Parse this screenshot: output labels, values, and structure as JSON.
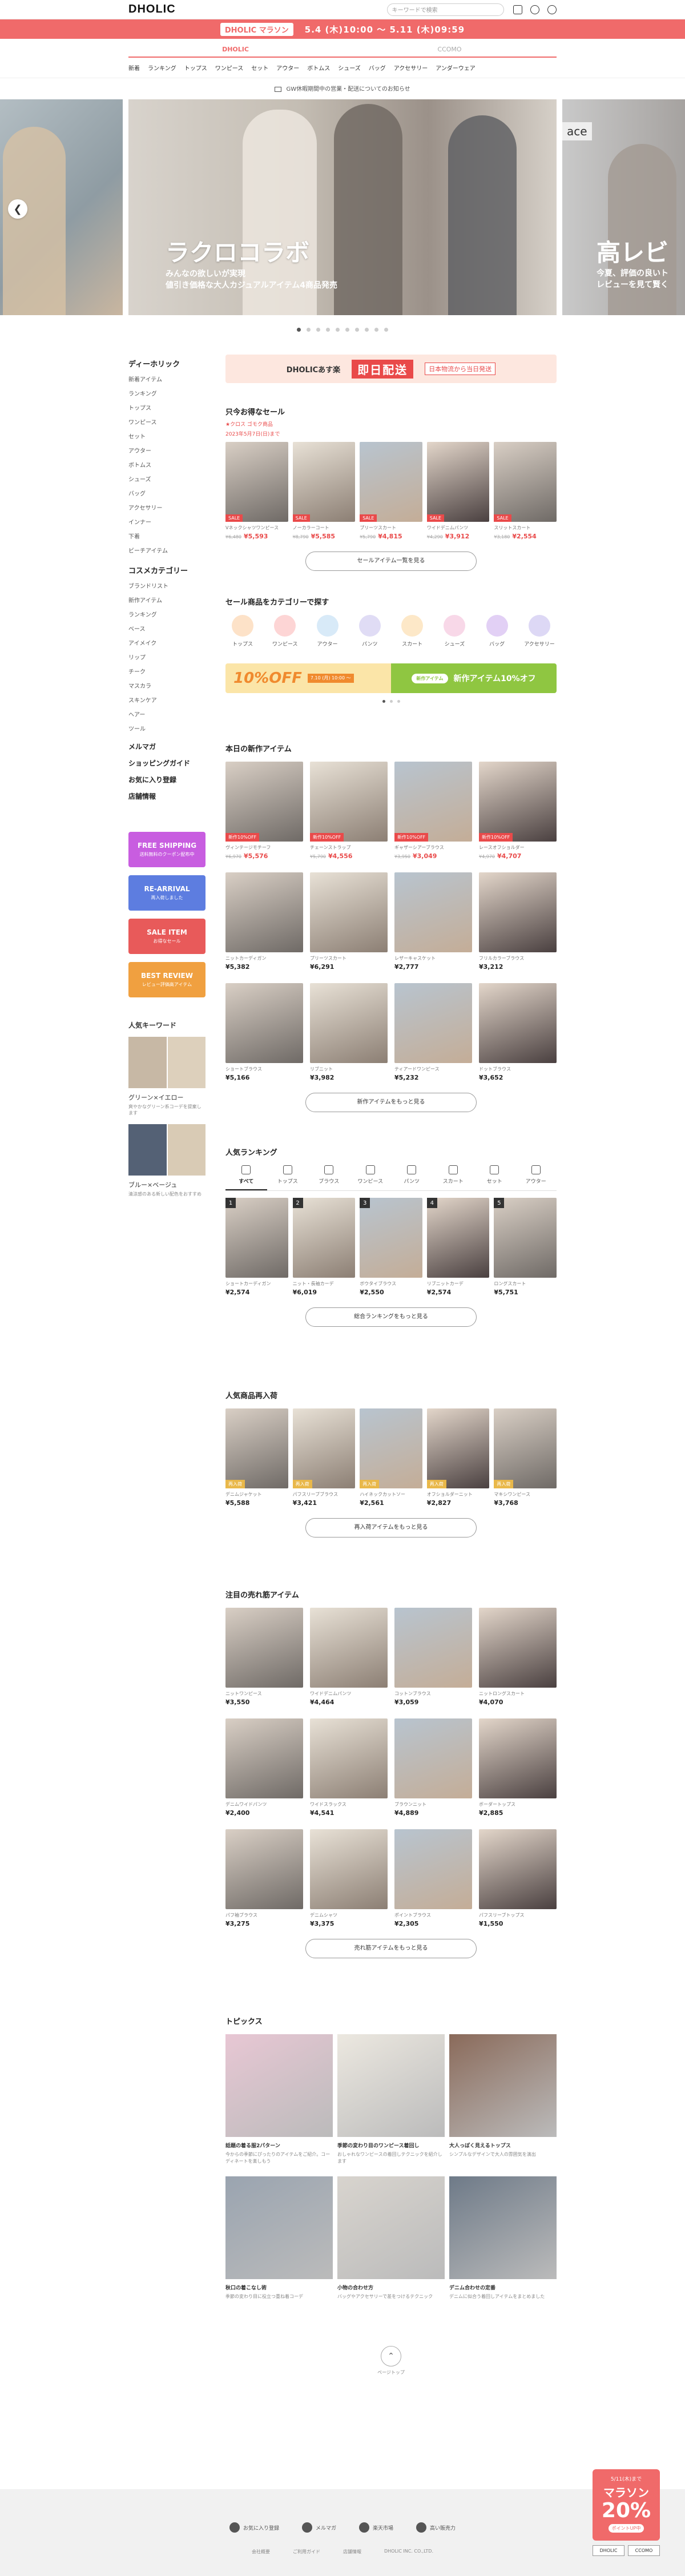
{
  "header": {
    "logo": "DHOLIC",
    "search_placeholder": "キーワードで検索",
    "promo_badge": "DHOLIC マラソン",
    "promo_dates": "5.4 (木)10:00 ～ 5.11 (木)09:59",
    "brand_tabs": [
      "DHOLIC",
      "CCOMO"
    ]
  },
  "catnav": [
    "新着",
    "ランキング",
    "トップス",
    "ワンピース",
    "セット",
    "アウター",
    "ボトムス",
    "シューズ",
    "バッグ",
    "アクセサリー",
    "アンダーウェア"
  ],
  "notice": "GW休暇期間中の営業・配送についてのお知らせ",
  "hero": {
    "main_title": "ラクロコラボ",
    "main_sub1": "みんなの欲しいが実現",
    "main_sub2": "値引き価格な大人カジュアルアイテム4商品発売",
    "next_label": "ace",
    "next_title": "高レビ",
    "next_sub1": "今夏、評価の良いト",
    "next_sub2": "レビューを見て賢く"
  },
  "sidebar": {
    "dholic_h": "ディーホリック",
    "dholic_items": [
      "新着アイテム",
      "ランキング",
      "トップス",
      "ワンピース",
      "セット",
      "アウター",
      "ボトムス",
      "シューズ",
      "バッグ",
      "アクセサリー",
      "インナー",
      "下着",
      "ビーチアイテム"
    ],
    "cosme_h": "コスメカテゴリー",
    "cosme_items": [
      "ブランドリスト",
      "新作アイテム",
      "ランキング",
      "ベース",
      "アイメイク",
      "リップ",
      "チーク",
      "マスカラ",
      "スキンケア",
      "ヘアー",
      "ツール"
    ],
    "links": [
      "メルマガ",
      "ショッピングガイド",
      "お気に入り登録",
      "店舗情報"
    ],
    "banners": [
      {
        "t": "FREE SHIPPING",
        "s": "送料無料のクーポン配布中"
      },
      {
        "t": "RE-ARRIVAL",
        "s": "再入荷しました"
      },
      {
        "t": "SALE ITEM",
        "s": "お得なセール"
      },
      {
        "t": "BEST REVIEW",
        "s": "レビュー評価高アイテム"
      }
    ],
    "kw_title": "人気キーワード",
    "keywords": [
      {
        "name": "グリーン×イエロー",
        "desc": "爽やかなグリーン系コーデを提案します"
      },
      {
        "name": "ブルー×ベージュ",
        "desc": "清涼感のある新しい配色をおすすめ"
      }
    ]
  },
  "delivery": {
    "brand": "DHOLICあす楽",
    "red": "即日配送",
    "txt": "日本物流から当日発送"
  },
  "sale": {
    "title": "只今お得なセール",
    "sub1": "★クロス ゴモク商品",
    "sub2": "2023年5月7日(日)まで",
    "items": [
      {
        "name": "Vネックシャツワンピース",
        "old": "¥6,480",
        "price": "¥5,593",
        "tag": "SALE"
      },
      {
        "name": "ノーカラーコート",
        "old": "¥8,790",
        "price": "¥5,585",
        "tag": "SALE"
      },
      {
        "name": "プリーツスカート",
        "old": "¥5,790",
        "price": "¥4,815",
        "tag": "SALE"
      },
      {
        "name": "ワイドデニムパンツ",
        "old": "¥4,290",
        "price": "¥3,912",
        "tag": "SALE"
      },
      {
        "name": "スリットスカート",
        "old": "¥3,180",
        "price": "¥2,554",
        "tag": "SALE"
      }
    ],
    "more": "セールアイテム一覧を見る"
  },
  "catsale": {
    "title": "セール商品をカテゴリーで探す",
    "cats": [
      "トップス",
      "ワンピース",
      "アウター",
      "パンツ",
      "スカート",
      "シューズ",
      "バッグ",
      "アクセサリー"
    ]
  },
  "disc": {
    "pct": "10%OFF",
    "date": "7.10 (月) 10:00 ～",
    "pill": "新作アイテム",
    "txt": "新作アイテム10%オフ"
  },
  "newitems": {
    "title": "本日の新作アイテム",
    "items": [
      {
        "name": "ヴィンテージモチーフ",
        "old": "¥6,970",
        "price": "¥5,576",
        "tag": "新作10%OFF"
      },
      {
        "name": "チェーンストラップ",
        "old": "¥5,790",
        "price": "¥4,556",
        "tag": "新作10%OFF"
      },
      {
        "name": "ギャザーシアーブラウス",
        "old": "¥3,950",
        "price": "¥3,049",
        "tag": "新作10%OFF"
      },
      {
        "name": "レースオフショルダー",
        "old": "¥4,970",
        "price": "¥4,707",
        "tag": "新作10%OFF"
      },
      {
        "name": "ニットカーディガン",
        "price": "¥5,382"
      },
      {
        "name": "プリーツスカート",
        "price": "¥6,291"
      },
      {
        "name": "レザーキャスケット",
        "price": "¥2,777"
      },
      {
        "name": "フリルカラーブラウス",
        "price": "¥3,212"
      },
      {
        "name": "ショートブラウス",
        "price": "¥5,166"
      },
      {
        "name": "リブニット",
        "price": "¥3,982"
      },
      {
        "name": "ティアードワンピース",
        "price": "¥5,232"
      },
      {
        "name": "ドットブラウス",
        "price": "¥3,652"
      }
    ],
    "more": "新作アイテムをもっと見る"
  },
  "ranking": {
    "title": "人気ランキング",
    "tabs": [
      "すべて",
      "トップス",
      "ブラウス",
      "ワンピース",
      "パンツ",
      "スカート",
      "セット",
      "アウター"
    ],
    "items": [
      {
        "name": "ショートカーディガン",
        "price": "¥2,574"
      },
      {
        "name": "ニット・長袖カーデ",
        "price": "¥6,019"
      },
      {
        "name": "ボウタイブラウス",
        "price": "¥2,550"
      },
      {
        "name": "リブニットカーデ",
        "price": "¥2,574"
      },
      {
        "name": "ロングスカート",
        "price": "¥5,751"
      }
    ],
    "more": "総合ランキングをもっと見る"
  },
  "restock": {
    "title": "人気商品再入荷",
    "items": [
      {
        "name": "デニムジャケット",
        "price": "¥5,588",
        "tag": "再入荷"
      },
      {
        "name": "パフスリーブブラウス",
        "price": "¥3,421",
        "tag": "再入荷"
      },
      {
        "name": "ハイネックカットソー",
        "price": "¥2,561",
        "tag": "再入荷"
      },
      {
        "name": "オフショルダーニット",
        "price": "¥2,827",
        "tag": "再入荷"
      },
      {
        "name": "マキシワンピース",
        "price": "¥3,768",
        "tag": "再入荷"
      }
    ],
    "more": "再入荷アイテムをもっと見る"
  },
  "attention": {
    "title": "注目の売れ筋アイテム",
    "items": [
      {
        "name": "ニットワンピース",
        "price": "¥3,550"
      },
      {
        "name": "ワイドデニムパンツ",
        "price": "¥4,464"
      },
      {
        "name": "コットンブラウス",
        "price": "¥3,059"
      },
      {
        "name": "ニットロングスカート",
        "price": "¥4,070"
      },
      {
        "name": "デニムワイドパンツ",
        "price": "¥2,400"
      },
      {
        "name": "ワイドスラックス",
        "price": "¥4,541"
      },
      {
        "name": "ブラウンニット",
        "price": "¥4,889"
      },
      {
        "name": "ボーダートップス",
        "price": "¥2,885"
      },
      {
        "name": "パフ袖ブラウス",
        "price": "¥3,275"
      },
      {
        "name": "デニムシャツ",
        "price": "¥3,375"
      },
      {
        "name": "ポイントブラウス",
        "price": "¥2,305"
      },
      {
        "name": "パフスリーブトップス",
        "price": "¥1,550"
      }
    ],
    "more": "売れ筋アイテムをもっと見る"
  },
  "topics": {
    "title": "トピックス",
    "items": [
      {
        "t": "話題の着る服2パターン",
        "d": "今からの季節にぴったりのアイテムをご紹介。コーディネートを楽しもう"
      },
      {
        "t": "季節の変わり目のワンピース着回し",
        "d": "おしゃれなワンピースの着回しテクニックを紹介します"
      },
      {
        "t": "大人っぽく見えるトップス",
        "d": "シンプルなデザインで大人の雰囲気を演出"
      },
      {
        "t": "秋口の着こなし術",
        "d": "季節の変わり目に役立つ重ね着コーデ"
      },
      {
        "t": "小物の合わせ方",
        "d": "バッグやアクセサリーで差をつけるテクニック"
      },
      {
        "t": "デニム合わせの定番",
        "d": "デニムに似合う着回しアイテムをまとめました"
      }
    ]
  },
  "pagetop": "ページトップ",
  "footer": {
    "links": [
      "お気に入り登録",
      "メルマガ",
      "楽天市場",
      "高い販売力"
    ],
    "sub": [
      "会社概要",
      "ご利用ガイド",
      "店舗情報",
      "DHOLIC INC. CO.,LTD."
    ]
  },
  "float": {
    "a": "5/11(木)まで",
    "b": "マラソン",
    "c": "20%",
    "d": "ポイントUP中",
    "tabs": [
      "DHOLIC",
      "CCOMO"
    ]
  }
}
